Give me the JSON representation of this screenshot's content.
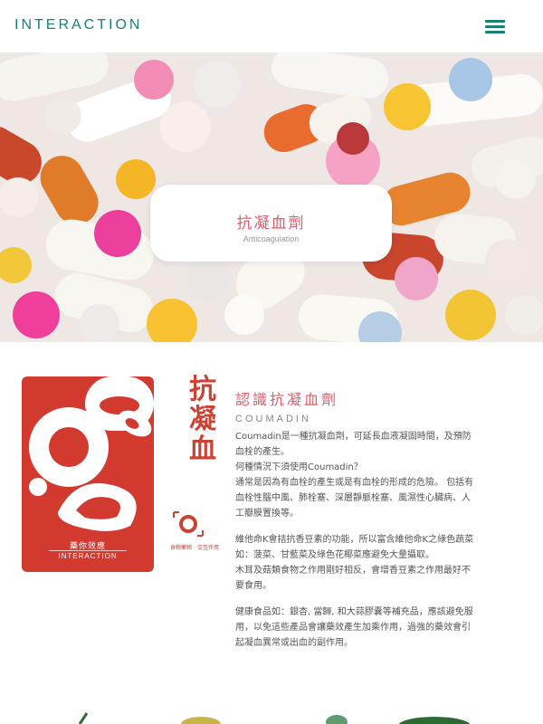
{
  "header": {
    "brand": "INTERACTION",
    "menu_icon": "hamburger-menu-icon",
    "accent_color": "#1a7f79"
  },
  "hero": {
    "title": "抗凝血劑",
    "subtitle": "Anticoagulation",
    "image": "photo of assorted colorful pills and capsules"
  },
  "poster": {
    "vertical_title": [
      "抗",
      "凝",
      "血"
    ],
    "brand_cn": "藥你效應",
    "brand_en": "INTERACTION",
    "caption": "食物藥物　交互作用"
  },
  "section": {
    "title": "認識抗凝血劑",
    "subtitle": "COUMADIN",
    "title_color": "#e25a6a",
    "paragraphs": [
      [
        "Coumadin是一種抗凝血劑，可延長血液凝固時間，及預防",
        "血栓的產生。",
        "何種情況下須使用Coumadin？",
        "通常是因為有血栓的產生或是有血栓的形成的危險。 包括有",
        "血栓性腦中風、肺栓塞、深層靜脈栓塞、風濕性心臟病、人",
        "工瓣膜置換等。"
      ],
      [
        "維他命K會拮抗香豆素的功能，所以富含維他命K之綠色蔬菜",
        "如：菠菜、甘藍菜及綠色花椰菜應避免大量攝取。",
        "木耳及菇類食物之作用剛好相反，會增香豆素之作用最好不",
        "要食用。"
      ],
      [
        "健康食品如：銀杏, 當歸, 和大蒜膠囊等補充品，應該避免服",
        "用，以免這些產品會讓藥效產生加乘作用，過強的藥效會引",
        "起凝血異常或出血的副作用。"
      ]
    ]
  }
}
